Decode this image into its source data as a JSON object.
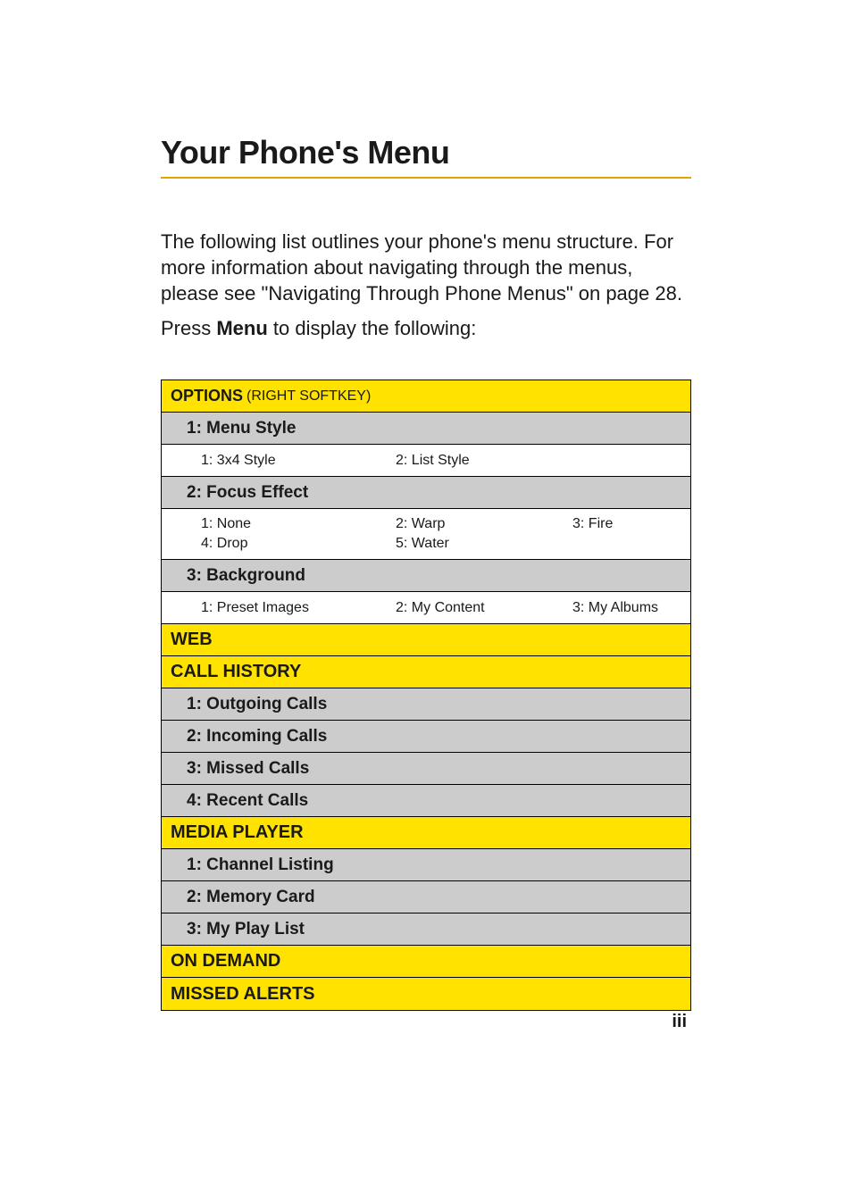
{
  "title": "Your Phone's Menu",
  "intro": "The following list outlines your phone's menu structure. For more information about navigating through the menus, please see \"Navigating Through Phone Menus\" on page 28.",
  "press_prefix": "Press ",
  "press_bold": "Menu",
  "press_suffix": " to display the following:",
  "page_number": "iii",
  "options_header": {
    "label": "OPTIONS",
    "suffix": " (RIGHT SOFTKEY)"
  },
  "sections": {
    "options": {
      "menu_style": {
        "header": "1: Menu Style",
        "c11": "1: 3x4 Style",
        "c12": "2: List Style",
        "c13": ""
      },
      "focus_effect": {
        "header": "2: Focus Effect",
        "c11": "1: None",
        "c12": "2: Warp",
        "c13": "3: Fire",
        "c21": "4: Drop",
        "c22": "5: Water",
        "c23": ""
      },
      "background": {
        "header": "3: Background",
        "c11": "1: Preset Images",
        "c12": "2: My Content",
        "c13": "3: My Albums"
      }
    },
    "web": {
      "label": "WEB"
    },
    "call_history": {
      "label": "CALL HISTORY",
      "i1": "1: Outgoing Calls",
      "i2": "2: Incoming Calls",
      "i3": "3: Missed Calls",
      "i4": "4: Recent Calls"
    },
    "media_player": {
      "label": "MEDIA PLAYER",
      "i1": "1: Channel Listing",
      "i2": "2: Memory Card",
      "i3": "3: My Play List"
    },
    "on_demand": {
      "label": "ON DEMAND"
    },
    "missed_alerts": {
      "label": "MISSED ALERTS"
    }
  }
}
